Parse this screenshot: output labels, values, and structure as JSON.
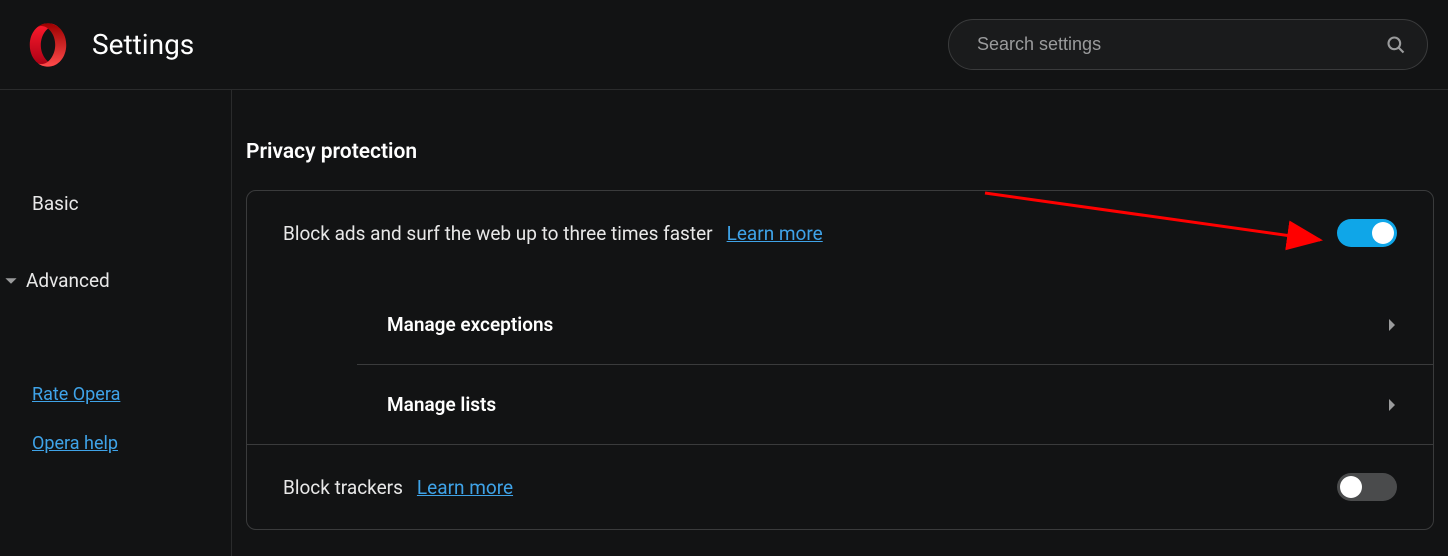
{
  "header": {
    "title": "Settings",
    "search_placeholder": "Search settings"
  },
  "sidebar": {
    "nav": {
      "basic": "Basic",
      "advanced": "Advanced"
    },
    "links": {
      "rate": "Rate Opera",
      "help": "Opera help"
    }
  },
  "main": {
    "section_title": "Privacy protection",
    "block_ads": {
      "label": "Block ads and surf the web up to three times faster",
      "learn_more": "Learn more",
      "enabled": true,
      "sub": {
        "exceptions": "Manage exceptions",
        "lists": "Manage lists"
      }
    },
    "block_trackers": {
      "label": "Block trackers",
      "learn_more": "Learn more",
      "enabled": false
    }
  }
}
